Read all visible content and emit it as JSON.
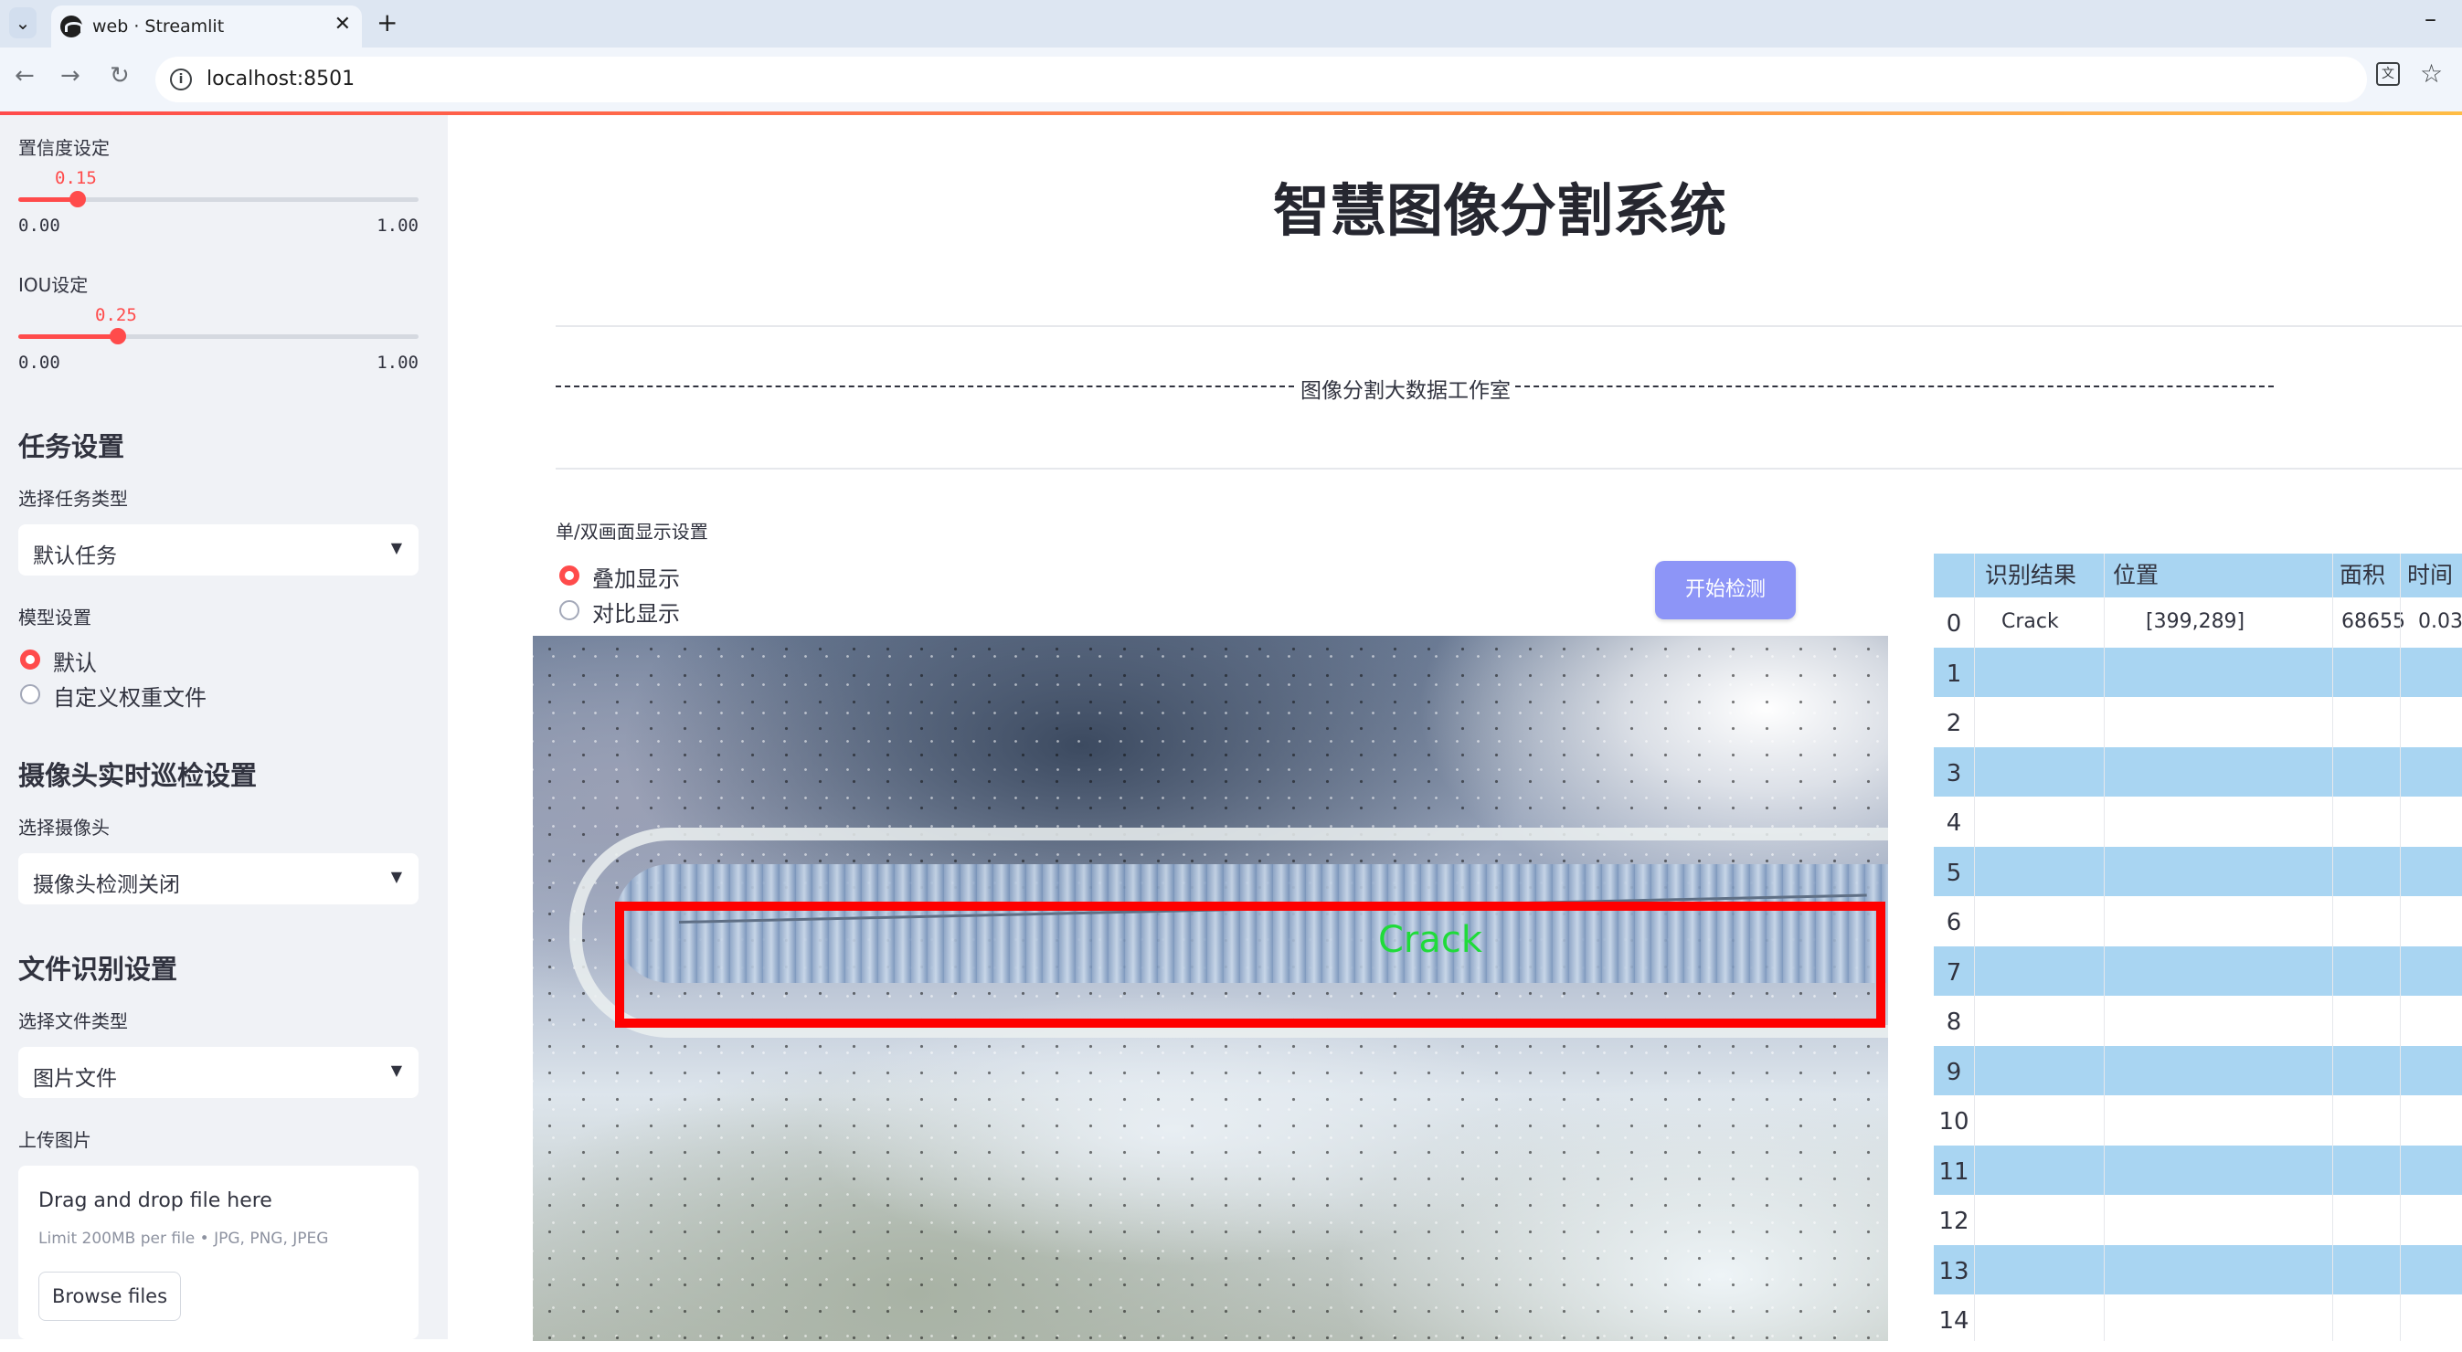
{
  "browser": {
    "tab_title": "web · Streamlit",
    "url": "localhost:8501"
  },
  "sidebar": {
    "confidence": {
      "label": "置信度设定",
      "value": "0.15",
      "value_fraction": 0.15,
      "min": "0.00",
      "max": "1.00"
    },
    "iou": {
      "label": "IOU设定",
      "value": "0.25",
      "value_fraction": 0.25,
      "min": "0.00",
      "max": "1.00"
    },
    "task": {
      "header": "任务设置",
      "select_label": "选择任务类型",
      "selected": "默认任务"
    },
    "model": {
      "label": "模型设置",
      "options": [
        "默认",
        "自定义权重文件"
      ],
      "selected_index": 0
    },
    "camera": {
      "header": "摄像头实时巡检设置",
      "select_label": "选择摄像头",
      "selected": "摄像头检测关闭"
    },
    "file": {
      "header": "文件识别设置",
      "select_label": "选择文件类型",
      "selected": "图片文件"
    },
    "upload": {
      "label": "上传图片",
      "drop_text": "Drag and drop file here",
      "limit_text": "Limit 200MB per file • JPG, PNG, JPEG",
      "button": "Browse files"
    }
  },
  "main": {
    "title": "智慧图像分割系统",
    "studio_text": "图像分割大数据工作室",
    "display_label": "单/双画面显示设置",
    "display_options": [
      "叠加显示",
      "对比显示"
    ],
    "display_selected_index": 0,
    "start_button": "开始检测",
    "detection_label": "Crack"
  },
  "table": {
    "headers": [
      "识别结果",
      "位置",
      "面积",
      "时间"
    ],
    "rows": [
      {
        "idx": "0",
        "result": "Crack",
        "position": "[399,289]",
        "area": "68655",
        "time": "0.03"
      },
      {
        "idx": "1"
      },
      {
        "idx": "2"
      },
      {
        "idx": "3"
      },
      {
        "idx": "4"
      },
      {
        "idx": "5"
      },
      {
        "idx": "6"
      },
      {
        "idx": "7"
      },
      {
        "idx": "8"
      },
      {
        "idx": "9"
      },
      {
        "idx": "10"
      },
      {
        "idx": "11"
      },
      {
        "idx": "12"
      },
      {
        "idx": "13"
      },
      {
        "idx": "14"
      }
    ]
  },
  "colors": {
    "accent": "#ff4b4b",
    "button": "#8d95f7",
    "table_stripe": "#a9d5f2",
    "box": "#ff0000",
    "label": "#1fdb3a"
  }
}
